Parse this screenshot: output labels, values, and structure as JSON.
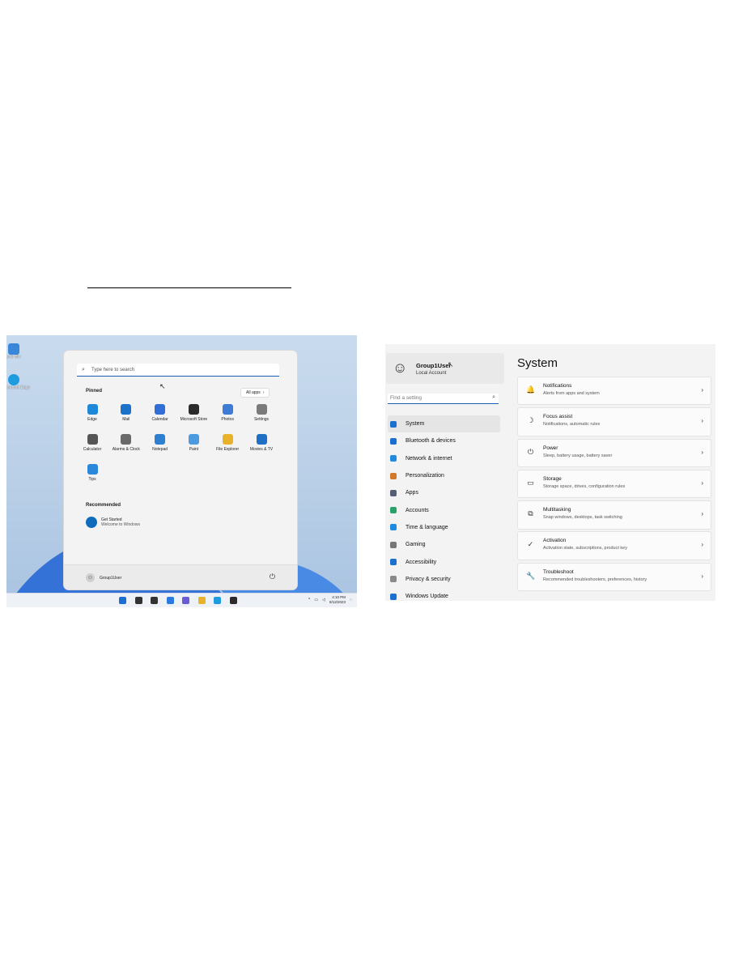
{
  "start_menu": {
    "desktop_icons": [
      {
        "label": "ycle Bin",
        "color": "#3a86d9"
      },
      {
        "label": "icrosoft Edge",
        "color": "#1f9be0"
      }
    ],
    "search_placeholder": "Type here to search",
    "pinned_label": "Pinned",
    "all_apps_label": "All apps",
    "all_apps_chevron": "›",
    "pinned_apps": [
      {
        "label": "Edge",
        "color": "#1e88d8"
      },
      {
        "label": "Mail",
        "color": "#1a73c8"
      },
      {
        "label": "Calendar",
        "color": "#2f6fd6"
      },
      {
        "label": "Microsoft Store",
        "color": "#2b2b2b"
      },
      {
        "label": "Photos",
        "color": "#3d7bd4"
      },
      {
        "label": "Settings",
        "color": "#7a7a7a"
      },
      {
        "label": "Calculator",
        "color": "#555555"
      },
      {
        "label": "Alarms & Clock",
        "color": "#6a6a6a"
      },
      {
        "label": "Notepad",
        "color": "#2d7fd1"
      },
      {
        "label": "Paint",
        "color": "#4a9be0"
      },
      {
        "label": "File Explorer",
        "color": "#e8b32a"
      },
      {
        "label": "Movies & TV",
        "color": "#1f6fc4"
      },
      {
        "label": "Tips",
        "color": "#2a87da"
      }
    ],
    "recommended_label": "Recommended",
    "recommended_items": [
      {
        "title": "Get Started",
        "subtitle": "Welcome to Windows"
      }
    ],
    "user_name": "Group1User",
    "power_icon": "⏻",
    "taskbar": {
      "icons": [
        {
          "name": "start-icon",
          "color": "#1c6fd1"
        },
        {
          "name": "search-icon",
          "color": "#333333"
        },
        {
          "name": "task-view-icon",
          "color": "#333333"
        },
        {
          "name": "widgets-icon",
          "color": "#2a7be0"
        },
        {
          "name": "chat-icon",
          "color": "#6a5bd6"
        },
        {
          "name": "file-explorer-icon",
          "color": "#e8b32a"
        },
        {
          "name": "edge-icon",
          "color": "#1f9be0"
        },
        {
          "name": "store-icon",
          "color": "#2b2b2b"
        }
      ],
      "time": "4:10 PM",
      "date": "8/12/2023"
    }
  },
  "settings": {
    "profile": {
      "name": "Group1User",
      "account_type": "Local Account"
    },
    "search_placeholder": "Find a setting",
    "nav_items": [
      {
        "label": "System",
        "color": "#1a6fd1",
        "active": true
      },
      {
        "label": "Bluetooth & devices",
        "color": "#1a6fd1",
        "active": false
      },
      {
        "label": "Network & internet",
        "color": "#1f8be0",
        "active": false
      },
      {
        "label": "Personalization",
        "color": "#d27a2c",
        "active": false
      },
      {
        "label": "Apps",
        "color": "#555e72",
        "active": false
      },
      {
        "label": "Accounts",
        "color": "#2aa36a",
        "active": false
      },
      {
        "label": "Time & language",
        "color": "#1f8be0",
        "active": false
      },
      {
        "label": "Gaming",
        "color": "#777777",
        "active": false
      },
      {
        "label": "Accessibility",
        "color": "#1a6fd1",
        "active": false
      },
      {
        "label": "Privacy & security",
        "color": "#8a8a8a",
        "active": false
      },
      {
        "label": "Windows Update",
        "color": "#1a6fd1",
        "active": false
      }
    ],
    "page_title": "System",
    "cards": [
      {
        "title": "Notifications",
        "desc": "Alerts from apps and system",
        "icon": "🔔"
      },
      {
        "title": "Focus assist",
        "desc": "Notifications, automatic rules",
        "icon": "☽"
      },
      {
        "title": "Power",
        "desc": "Sleep, battery usage, battery saver",
        "icon": "⏻"
      },
      {
        "title": "Storage",
        "desc": "Storage space, drives, configuration rules",
        "icon": "▭"
      },
      {
        "title": "Multitasking",
        "desc": "Snap windows, desktops, task switching",
        "icon": "⧉"
      },
      {
        "title": "Activation",
        "desc": "Activation state, subscriptions, product key",
        "icon": "✓"
      },
      {
        "title": "Troubleshoot",
        "desc": "Recommended troubleshooters, preferences, history",
        "icon": "🔧"
      }
    ],
    "chevron": "›"
  }
}
